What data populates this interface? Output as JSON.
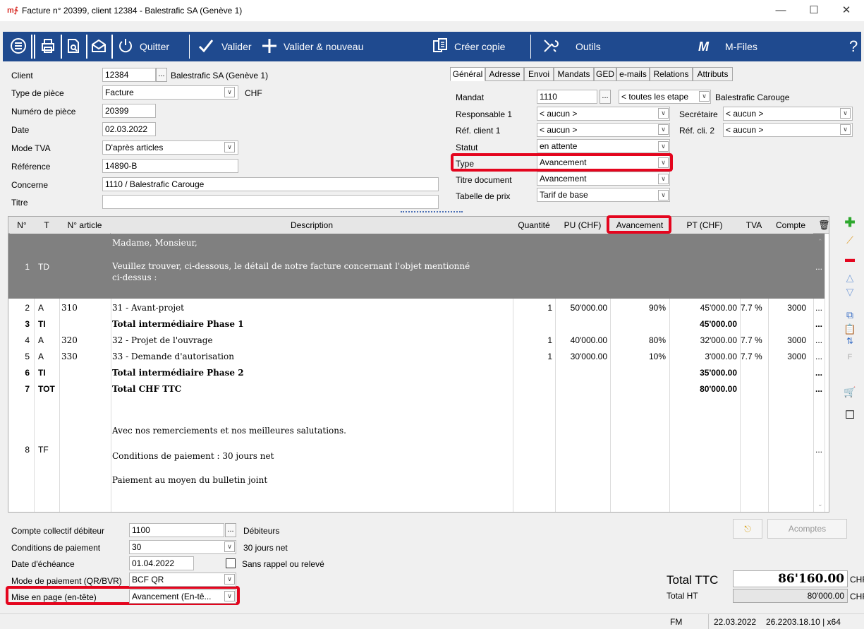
{
  "window": {
    "logo": "m∱",
    "title": "Facture n° 20399, client 12384 - Balestrafic SA (Genève 1)",
    "minimize": "—",
    "maximize": "☐",
    "close": "✕"
  },
  "toolbar": {
    "quit": "Quitter",
    "validate": "Valider",
    "validate_new": "Valider & nouveau",
    "copy": "Créer copie",
    "tools": "Outils",
    "mfiles_logo": "M",
    "mfiles": "M-Files",
    "help": "?"
  },
  "form": {
    "client_label": "Client",
    "client_value": "12384",
    "client_name": "Balestrafic SA (Genève 1)",
    "type_label": "Type de pièce",
    "type_value": "Facture",
    "currency": "CHF",
    "number_label": "Numéro de pièce",
    "number_value": "20399",
    "date_label": "Date",
    "date_value": "02.03.2022",
    "vat_label": "Mode TVA",
    "vat_value": "D'après articles",
    "ref_label": "Référence",
    "ref_value": "14890-B",
    "concerns_label": "Concerne",
    "concerns_value": "1110 / Balestrafic Carouge",
    "title_label": "Titre",
    "title_value": ""
  },
  "tabs": [
    "Général",
    "Adresse",
    "Envoi",
    "Mandats",
    "GED",
    "e-mails",
    "Relations",
    "Attributs"
  ],
  "general": {
    "mandate_label": "Mandat",
    "mandate_value": "1110",
    "stage_value": "< toutes les etape",
    "mandate_name": "Balestrafic Carouge",
    "resp_label": "Responsable 1",
    "resp_value": "< aucun >",
    "secretary_label": "Secrétaire",
    "secretary_value": "< aucun >",
    "refclient_label": "Réf. client 1",
    "refclient_value": "< aucun >",
    "refcli2_label": "Réf. cli. 2",
    "refcli2_value": "< aucun >",
    "status_label": "Statut",
    "status_value": "en attente",
    "type_label": "Type",
    "type_value": "Avancement",
    "doctitle_label": "Titre document",
    "doctitle_value": "Avancement",
    "pricetable_label": "Tabelle de prix",
    "pricetable_value": "Tarif de base"
  },
  "grid": {
    "headers": {
      "no": "N°",
      "t": "T",
      "article": "N° article",
      "desc": "Description",
      "qty": "Quantité",
      "pu": "PU (CHF)",
      "progress": "Avancement",
      "pt": "PT (CHF)",
      "vat": "TVA",
      "account": "Compte"
    },
    "header_row": {
      "no": "1",
      "t": "TD",
      "line1": "Madame, Monsieur,",
      "line2": "Veuillez trouver, ci-dessous, le détail de notre facture concernant l'objet mentionné",
      "line3": "ci-dessus :",
      "more": "..."
    },
    "rows": [
      {
        "no": "2",
        "t": "A",
        "article": "310",
        "desc": "31 - Avant-projet",
        "qty": "1",
        "pu": "50'000.00",
        "progress": "90%",
        "pt": "45'000.00",
        "vat": "7.7 %",
        "account": "3000",
        "more": "..."
      },
      {
        "no": "3",
        "t": "TI",
        "article": "",
        "desc": "Total intermédiaire Phase 1",
        "qty": "",
        "pu": "",
        "progress": "",
        "pt": "45'000.00",
        "vat": "",
        "account": "",
        "more": "..."
      },
      {
        "no": "4",
        "t": "A",
        "article": "320",
        "desc": "32 - Projet de l'ouvrage",
        "qty": "1",
        "pu": "40'000.00",
        "progress": "80%",
        "pt": "32'000.00",
        "vat": "7.7 %",
        "account": "3000",
        "more": "..."
      },
      {
        "no": "5",
        "t": "A",
        "article": "330",
        "desc": "33 - Demande d'autorisation",
        "qty": "1",
        "pu": "30'000.00",
        "progress": "10%",
        "pt": "3'000.00",
        "vat": "7.7 %",
        "account": "3000",
        "more": "..."
      },
      {
        "no": "6",
        "t": "TI",
        "article": "",
        "desc": "Total intermédiaire Phase 2",
        "qty": "",
        "pu": "",
        "progress": "",
        "pt": "35'000.00",
        "vat": "",
        "account": "",
        "more": "..."
      },
      {
        "no": "7",
        "t": "TOT",
        "article": "",
        "desc": "Total CHF TTC",
        "qty": "",
        "pu": "",
        "progress": "",
        "pt": "80'000.00",
        "vat": "",
        "account": "",
        "more": "..."
      }
    ],
    "footer_row": {
      "no": "8",
      "t": "TF",
      "line1": "Avec nos remerciements et nos meilleures salutations.",
      "line2": "Conditions de paiement : 30 jours net",
      "line3": "Paiement au moyen du bulletin joint",
      "more": "..."
    }
  },
  "bottom": {
    "account_label": "Compte collectif débiteur",
    "account_value": "1100",
    "account_name": "Débiteurs",
    "terms_label": "Conditions de paiement",
    "terms_value": "30",
    "terms_name": "30 jours net",
    "due_label": "Date d'échéance",
    "due_value": "01.04.2022",
    "noreminder_label": "Sans rappel ou relevé",
    "paymode_label": "Mode de paiement (QR/BVR)",
    "paymode_value": "BCF QR",
    "layout_label": "Mise en page (en-tête)",
    "layout_value": "Avancement (En-tê...",
    "acomptes": "Acomptes"
  },
  "totals": {
    "ttc_label": "Total TTC",
    "ttc_value": "86'160.00",
    "ttc_cur": "CHF",
    "ht_label": "Total HT",
    "ht_value": "80'000.00",
    "ht_cur": "CHF"
  },
  "status": {
    "mode": "FM",
    "date": "22.03.2022",
    "version": "26.2203.18.10 | x64"
  },
  "colors": {
    "toolbar": "#1f4a8f",
    "highlight": "#e4051e",
    "grid_selected": "#808080"
  }
}
